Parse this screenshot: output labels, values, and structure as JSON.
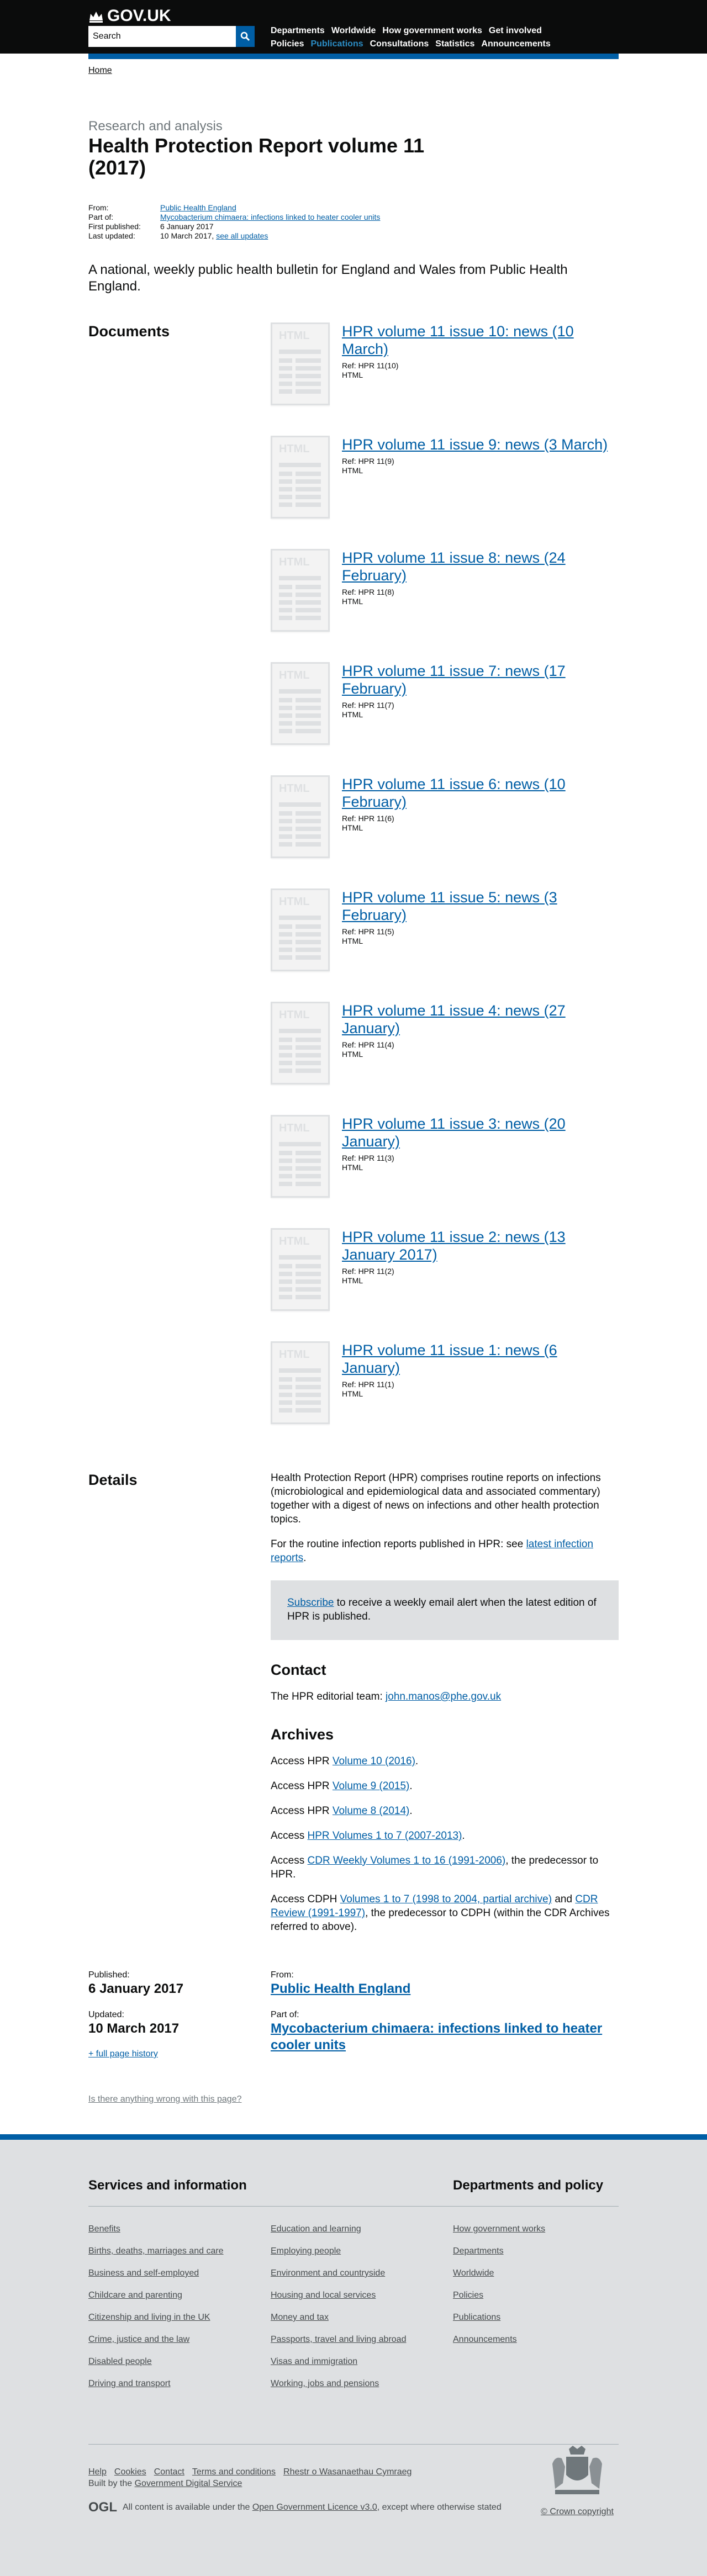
{
  "header": {
    "logo_text": "GOV.UK",
    "search_placeholder": "Search",
    "nav": [
      "Departments",
      "Worldwide",
      "How government works",
      "Get involved",
      "Policies",
      "Publications",
      "Consultations",
      "Statistics",
      "Announcements"
    ],
    "active_nav": "Publications"
  },
  "breadcrumb": {
    "home": "Home"
  },
  "title": {
    "context": "Research and analysis",
    "heading": "Health Protection Report volume 11 (2017)"
  },
  "meta": {
    "from_label": "From:",
    "from_value": "Public Health England",
    "part_of_label": "Part of:",
    "part_of_value": "Mycobacterium chimaera: infections linked to heater cooler units",
    "first_published_label": "First published:",
    "first_published_value": "6 January 2017",
    "last_updated_label": "Last updated:",
    "last_updated_value": "10 March 2017,",
    "see_all_updates": "see all updates"
  },
  "summary": "A national, weekly public health bulletin for England and Wales from Public Health England.",
  "documents": {
    "heading": "Documents",
    "thumb_label": "HTML",
    "items": [
      {
        "title": "HPR volume 11 issue 10: news (10 March)",
        "ref": "Ref: HPR 11(10)",
        "format": "HTML"
      },
      {
        "title": "HPR volume 11 issue 9: news (3 March)",
        "ref": "Ref: HPR 11(9)",
        "format": "HTML"
      },
      {
        "title": "HPR volume 11 issue 8: news (24 February)",
        "ref": "Ref: HPR 11(8)",
        "format": "HTML"
      },
      {
        "title": "HPR volume 11 issue 7: news (17 February)",
        "ref": "Ref: HPR 11(7)",
        "format": "HTML"
      },
      {
        "title": "HPR volume 11 issue 6: news (10 February)",
        "ref": "Ref: HPR 11(6)",
        "format": "HTML"
      },
      {
        "title": "HPR volume 11 issue 5: news (3 February)",
        "ref": "Ref: HPR 11(5)",
        "format": "HTML"
      },
      {
        "title": "HPR volume 11 issue 4: news (27 January)",
        "ref": "Ref: HPR 11(4)",
        "format": "HTML"
      },
      {
        "title": "HPR volume 11 issue 3: news (20 January)",
        "ref": "Ref: HPR 11(3)",
        "format": "HTML"
      },
      {
        "title": "HPR volume 11 issue 2: news (13 January 2017)",
        "ref": "Ref: HPR 11(2)",
        "format": "HTML"
      },
      {
        "title": "HPR volume 11 issue 1: news (6 January)",
        "ref": "Ref: HPR 11(1)",
        "format": "HTML"
      }
    ]
  },
  "details": {
    "heading": "Details",
    "para1": "Health Protection Report (HPR) comprises routine reports on infections (microbiological and epidemiological data and associated commentary) together with a digest of news on infections and other health protection topics.",
    "para2_prefix": "For the routine infection reports published in HPR: see ",
    "para2_link": "latest infection reports",
    "para2_suffix": ".",
    "callout_link": "Subscribe",
    "callout_text": " to receive a weekly email alert when the latest edition of HPR is published.",
    "contact_heading": "Contact",
    "contact_prefix": "The HPR editorial team: ",
    "contact_email": "john.manos@phe.gov.uk",
    "archives_heading": "Archives",
    "archives": [
      {
        "prefix": "Access HPR ",
        "link": "Volume 10 (2016)",
        "suffix": "."
      },
      {
        "prefix": "Access HPR ",
        "link": "Volume 9 (2015)",
        "suffix": "."
      },
      {
        "prefix": "Access HPR ",
        "link": "Volume 8 (2014)",
        "suffix": "."
      },
      {
        "prefix": "Access ",
        "link": "HPR Volumes 1 to 7 (2007-2013)",
        "suffix": "."
      },
      {
        "prefix": "Access ",
        "link": "CDR Weekly Volumes 1 to 16 (1991-2006)",
        "suffix": ", the predecessor to HPR."
      }
    ],
    "cdph_prefix": "Access CDPH ",
    "cdph_link1": "Volumes 1 to 7 (1998 to 2004, partial archive)",
    "cdph_middle": " and ",
    "cdph_link2": "CDR Review (1991-1997)",
    "cdph_suffix": ", the predecessor to CDPH (within the CDR Archives referred to above)."
  },
  "published": {
    "published_label": "Published:",
    "published_value": "6 January 2017",
    "updated_label": "Updated:",
    "updated_value": "10 March 2017",
    "history_link": "+ full page history",
    "from_label": "From:",
    "from_value": "Public Health England",
    "part_of_label": "Part of:",
    "part_of_value": "Mycobacterium chimaera: infections linked to heater cooler units"
  },
  "report_link": "Is there anything wrong with this page?",
  "footer": {
    "services_heading": "Services and information",
    "services": [
      "Benefits",
      "Education and learning",
      "Births, deaths, marriages and care",
      "Employing people",
      "Business and self-employed",
      "Environment and countryside",
      "Childcare and parenting",
      "Housing and local services",
      "Citizenship and living in the UK",
      "Money and tax",
      "Crime, justice and the law",
      "Passports, travel and living abroad",
      "Disabled people",
      "Visas and immigration",
      "Driving and transport",
      "Working, jobs and pensions"
    ],
    "departments_heading": "Departments and policy",
    "departments": [
      "How government works",
      "Departments",
      "Worldwide",
      "Policies",
      "Publications",
      "Announcements"
    ],
    "bottom_links": [
      "Help",
      "Cookies",
      "Contact",
      "Terms and conditions",
      "Rhestr o Wasanaethau Cymraeg"
    ],
    "built_prefix": "Built by the ",
    "built_link": "Government Digital Service",
    "ogl_mark": "OGL",
    "licence_prefix": "All content is available under the ",
    "licence_link": "Open Government Licence v3.0",
    "licence_suffix": ", except where otherwise stated",
    "copyright": "© Crown copyright"
  },
  "colors": {
    "brand_blue": "#005ea5",
    "header_black": "#0b0c0c",
    "footer_grey": "#dee0e2",
    "active_nav": "#2b8cc4"
  }
}
